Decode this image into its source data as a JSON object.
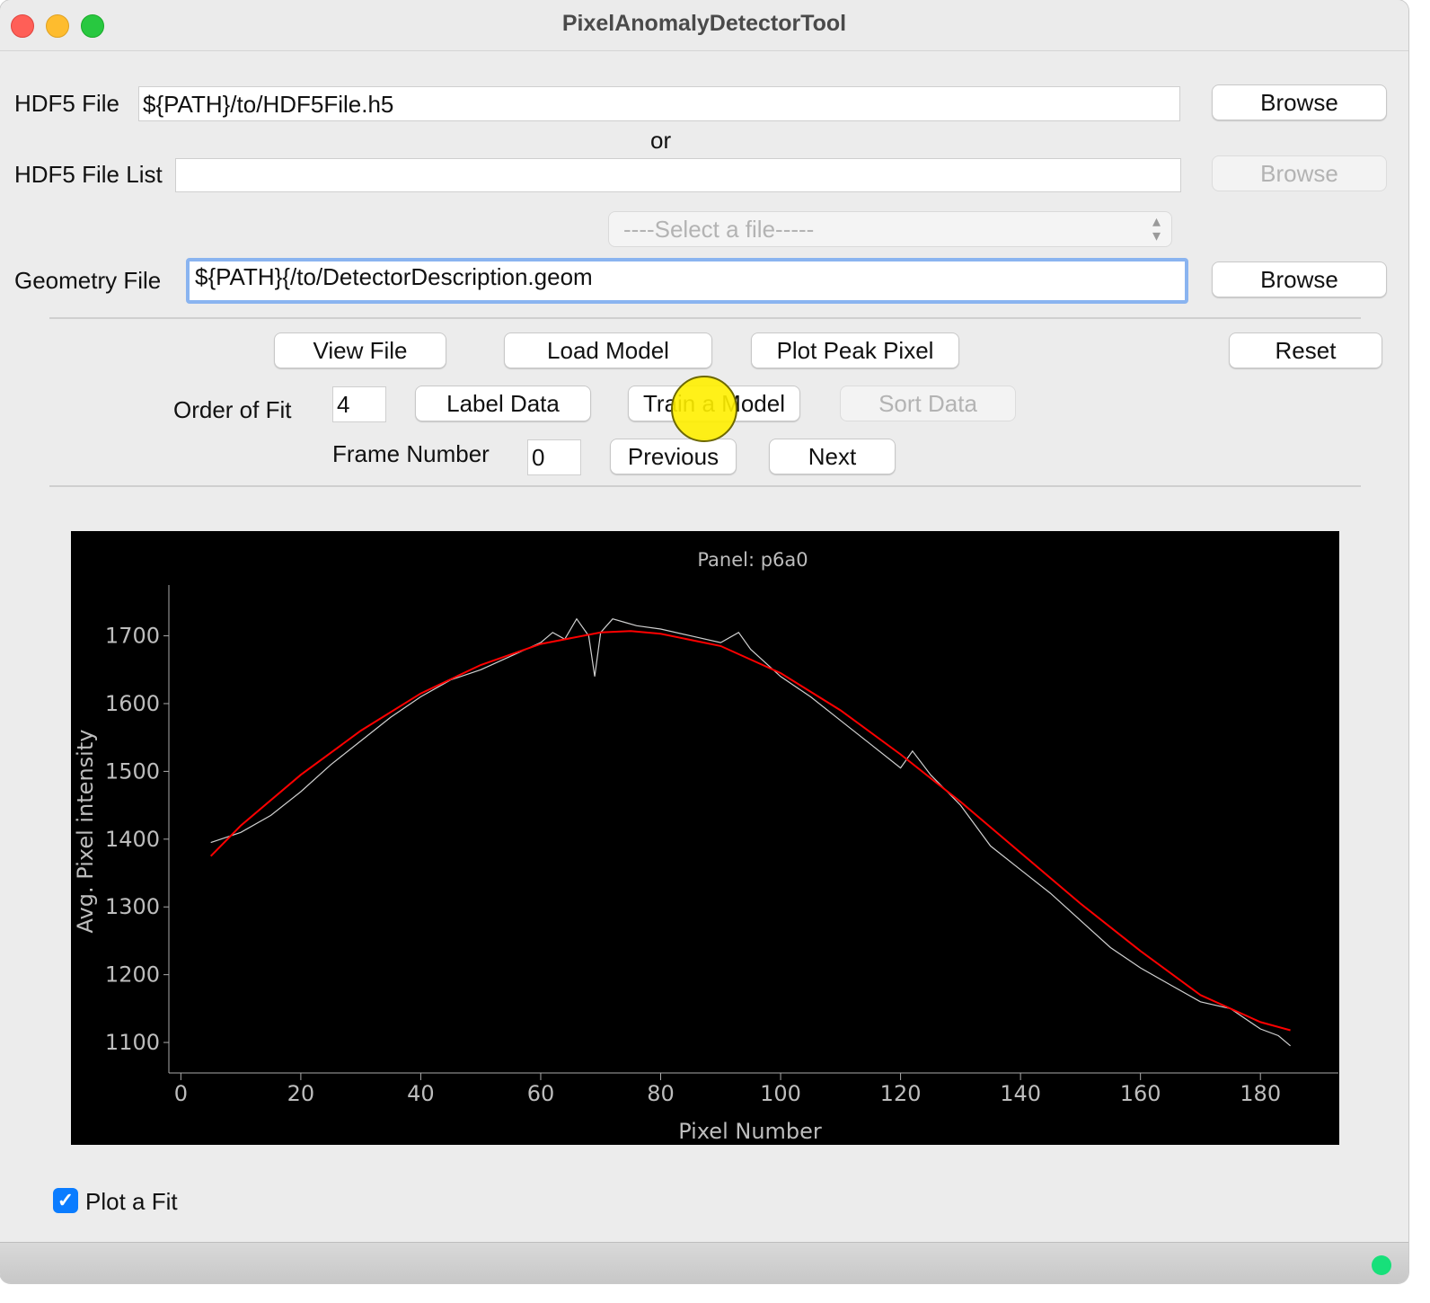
{
  "window": {
    "title": "PixelAnomalyDetectorTool"
  },
  "hdf5": {
    "label": "HDF5 File",
    "value": "${PATH}/to/HDF5File.h5",
    "browse": "Browse"
  },
  "or_text": "or",
  "hdf5_list": {
    "label": "HDF5 File List",
    "value": "",
    "browse": "Browse"
  },
  "file_select": {
    "placeholder": "----Select a file-----"
  },
  "geometry": {
    "label": "Geometry File",
    "value": "${PATH}{/to/DetectorDescription.geom",
    "browse": "Browse"
  },
  "toolbar": {
    "view_file": "View File",
    "load_model": "Load Model",
    "plot_peak_pixel": "Plot Peak Pixel",
    "reset": "Reset",
    "order_of_fit_label": "Order of Fit",
    "order_of_fit_value": "4",
    "label_data": "Label Data",
    "train_model": "Train a Model",
    "sort_data": "Sort Data",
    "frame_number_label": "Frame Number",
    "frame_number_value": "0",
    "previous": "Previous",
    "next": "Next"
  },
  "plot_fit": {
    "label": "Plot a Fit",
    "checked": true
  },
  "colors": {
    "plot_bg": "#000000",
    "data_line": "#d0d0d0",
    "fit_line": "#ff0000",
    "status_indicator": "#17e07a",
    "checkbox": "#0a7cff"
  },
  "chart_data": {
    "type": "line",
    "title": "Panel: p6a0",
    "xlabel": "Pixel Number",
    "ylabel": "Avg. Pixel intensity",
    "xlim": [
      -2,
      193
    ],
    "ylim": [
      1055,
      1775
    ],
    "xticks": [
      0,
      20,
      40,
      60,
      80,
      100,
      120,
      140,
      160,
      180
    ],
    "yticks": [
      1100,
      1200,
      1300,
      1400,
      1500,
      1600,
      1700
    ],
    "grid": false,
    "series": [
      {
        "kind": "data",
        "x": [
          5,
          10,
          15,
          20,
          25,
          30,
          35,
          40,
          45,
          50,
          55,
          60,
          62,
          64,
          66,
          68,
          69,
          70,
          72,
          74,
          76,
          80,
          85,
          90,
          93,
          95,
          100,
          105,
          110,
          115,
          120,
          122,
          125,
          130,
          135,
          140,
          145,
          150,
          155,
          160,
          165,
          170,
          175,
          180,
          183,
          185
        ],
        "y": [
          1395,
          1410,
          1435,
          1470,
          1510,
          1545,
          1580,
          1610,
          1635,
          1650,
          1670,
          1690,
          1705,
          1695,
          1725,
          1700,
          1640,
          1705,
          1725,
          1720,
          1715,
          1710,
          1700,
          1690,
          1705,
          1680,
          1640,
          1610,
          1575,
          1540,
          1505,
          1530,
          1495,
          1450,
          1390,
          1355,
          1320,
          1280,
          1240,
          1210,
          1185,
          1160,
          1150,
          1120,
          1110,
          1095
        ]
      },
      {
        "kind": "fit",
        "x": [
          5,
          10,
          20,
          30,
          40,
          50,
          60,
          70,
          75,
          80,
          90,
          100,
          110,
          120,
          130,
          140,
          150,
          160,
          170,
          180,
          185
        ],
        "y": [
          1375,
          1420,
          1495,
          1560,
          1615,
          1657,
          1688,
          1705,
          1707,
          1703,
          1685,
          1645,
          1590,
          1525,
          1455,
          1380,
          1305,
          1235,
          1170,
          1130,
          1118
        ]
      }
    ]
  }
}
